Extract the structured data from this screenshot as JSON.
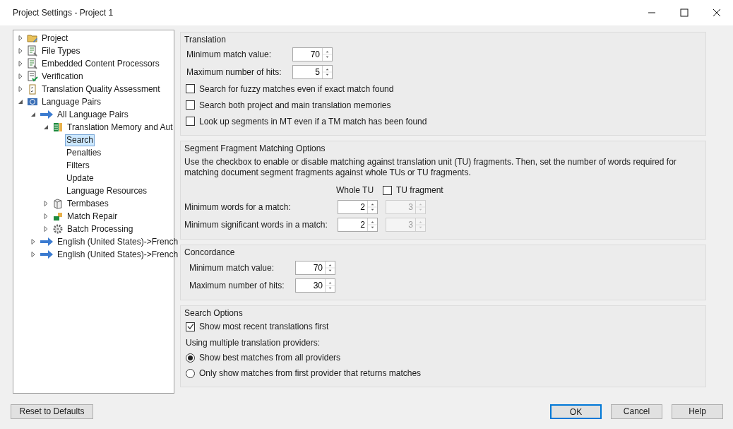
{
  "window": {
    "title": "Project Settings - Project 1"
  },
  "tree": [
    {
      "label": "Project",
      "kind": "folder",
      "expanded": false,
      "selected": false
    },
    {
      "label": "File Types",
      "kind": "document",
      "expanded": false,
      "selected": false
    },
    {
      "label": "Embedded Content Processors",
      "kind": "document",
      "expanded": false,
      "selected": false
    },
    {
      "label": "Verification",
      "kind": "check-document",
      "expanded": false,
      "selected": false
    },
    {
      "label": "Translation Quality Assessment",
      "kind": "clipboard",
      "expanded": false,
      "selected": false
    },
    {
      "label": "Language Pairs",
      "kind": "globe",
      "expanded": true,
      "selected": false,
      "children": [
        {
          "label": "All Language Pairs",
          "kind": "arrow",
          "expanded": true,
          "selected": false,
          "children": [
            {
              "label": "Translation Memory and Aut",
              "kind": "grid",
              "expanded": true,
              "selected": false,
              "children": [
                {
                  "label": "Search",
                  "selected": true
                },
                {
                  "label": "Penalties",
                  "selected": false
                },
                {
                  "label": "Filters",
                  "selected": false
                },
                {
                  "label": "Update",
                  "selected": false
                },
                {
                  "label": "Language Resources",
                  "selected": false
                }
              ]
            },
            {
              "label": "Termbases",
              "kind": "cube",
              "expanded": false,
              "selected": false
            },
            {
              "label": "Match Repair",
              "kind": "blocks",
              "expanded": false,
              "selected": false
            },
            {
              "label": "Batch Processing",
              "kind": "gear",
              "expanded": false,
              "selected": false
            }
          ]
        },
        {
          "label": "English (United States)->French",
          "kind": "arrow",
          "expanded": false,
          "selected": false
        },
        {
          "label": "English (United States)->French",
          "kind": "arrow",
          "expanded": false,
          "selected": false
        }
      ]
    }
  ],
  "translation": {
    "title": "Translation",
    "fields": [
      {
        "label": "Minimum match value:",
        "value": "70"
      },
      {
        "label": "Maximum number of hits:",
        "value": "5"
      }
    ],
    "options": [
      {
        "label": "Search for fuzzy matches even if exact match found",
        "checked": false
      },
      {
        "label": "Search both project and main translation memories",
        "checked": false
      },
      {
        "label": "Look up segments in MT even if a TM match has been found",
        "checked": false
      }
    ]
  },
  "fragment_matching": {
    "title": "Segment Fragment Matching Options",
    "description": "Use the checkbox to enable or disable matching against translation unit (TU) fragments. Then, set the number of words required for matching document segment fragments against whole TUs or TU fragments.",
    "whole_tu_header": "Whole TU",
    "tu_fragment": {
      "label": "TU fragment",
      "checked": false
    },
    "rows": [
      {
        "label": "Minimum words for a match:",
        "whole_tu": "2",
        "fragment": "3"
      },
      {
        "label": "Minimum significant words in a match:",
        "whole_tu": "2",
        "fragment": "3"
      }
    ]
  },
  "concordance": {
    "title": "Concordance",
    "fields": [
      {
        "label": "Minimum match value:",
        "value": "70"
      },
      {
        "label": "Maximum number of hits:",
        "value": "30"
      }
    ]
  },
  "search_options": {
    "title": "Search Options",
    "options": [
      {
        "label": "Show most recent translations first",
        "checked": true
      }
    ],
    "providers_label": "Using multiple translation providers:",
    "providers": [
      {
        "label": "Show best matches from all providers",
        "selected": true
      },
      {
        "label": "Only show matches from first provider that returns matches",
        "selected": false
      }
    ]
  },
  "buttons": [
    {
      "label": "Reset to Defaults",
      "default": false
    },
    {
      "label": "OK",
      "default": true
    },
    {
      "label": "Cancel",
      "default": false
    },
    {
      "label": "Help",
      "default": false
    }
  ]
}
